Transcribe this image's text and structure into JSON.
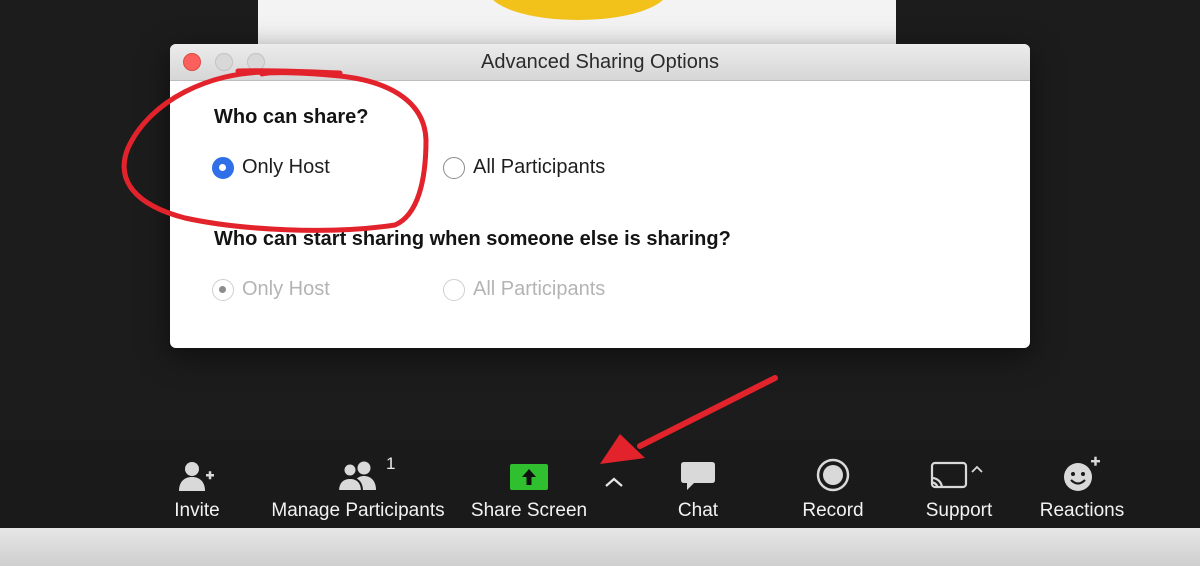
{
  "dialog": {
    "title": "Advanced Sharing Options",
    "section1": {
      "label": "Who can share?",
      "options": [
        {
          "label": "Only Host",
          "selected": true
        },
        {
          "label": "All Participants",
          "selected": false
        }
      ]
    },
    "section2": {
      "label": "Who can start sharing when someone else is sharing?",
      "options": [
        {
          "label": "Only Host",
          "selected": true,
          "disabled": true
        },
        {
          "label": "All Participants",
          "selected": false,
          "disabled": true
        }
      ]
    }
  },
  "toolbar": {
    "items": [
      {
        "label": "Invite",
        "icon": "add-person-icon"
      },
      {
        "label": "Manage Participants",
        "icon": "participants-icon",
        "count": "1"
      },
      {
        "label": "Share Screen",
        "icon": "share-screen-icon"
      },
      {
        "label": "Chat",
        "icon": "chat-icon"
      },
      {
        "label": "Record",
        "icon": "record-icon"
      },
      {
        "label": "Support",
        "icon": "support-cast-icon"
      },
      {
        "label": "Reactions",
        "icon": "reactions-icon"
      }
    ],
    "share_accent": "#2fbf2f"
  },
  "colors": {
    "radio_selected": "#2f6fe8",
    "annotation_red": "#e3232b",
    "close_button": "#fc605c"
  }
}
